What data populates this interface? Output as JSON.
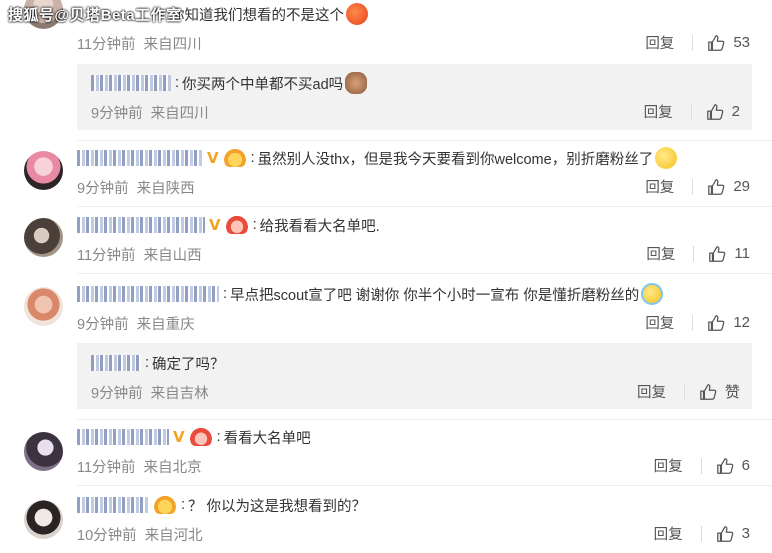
{
  "watermark": "搜狐号@贝塔Beta工作室",
  "reply_label": "回复",
  "comments": [
    {
      "text": "你知道我们想看的不是这个",
      "time": "11分钟前",
      "location": "来自四川",
      "likes": "53",
      "emoji": "angry-face-icon",
      "replies": [
        {
          "text": "你买两个中单都不买ad吗",
          "time": "9分钟前",
          "location": "来自四川",
          "likes": "2",
          "emoji": "monkey-icon"
        }
      ]
    },
    {
      "badge": "V",
      "text": "虽然别人没thx，但是我今天要看到你welcome，别折磨粉丝了",
      "time": "9分钟前",
      "location": "来自陕西",
      "likes": "29",
      "emoji": "smile-face-icon"
    },
    {
      "badge": "V",
      "text": "给我看看大名单吧.",
      "time": "11分钟前",
      "location": "来自山西",
      "likes": "11"
    },
    {
      "text": "早点把scout宣了吧 谢谢你 你半个小时一宣布 你是懂折磨粉丝的",
      "time": "9分钟前",
      "location": "来自重庆",
      "likes": "12",
      "emoji": "crying-face-icon",
      "replies": [
        {
          "text": "确定了吗？",
          "time": "9分钟前",
          "location": "来自吉林",
          "likes": "赞"
        }
      ]
    },
    {
      "badge": "V",
      "text": "看看大名单吧",
      "time": "11分钟前",
      "location": "来自北京",
      "likes": "6"
    },
    {
      "text": "？ 你以为这是我想看到的？",
      "time": "10分钟前",
      "location": "来自河北",
      "likes": "3"
    }
  ],
  "colors": {
    "meta_gray": "#888888",
    "text": "#333333",
    "reply_bg": "#f2f2f3",
    "v_badge": "#f2a420"
  }
}
